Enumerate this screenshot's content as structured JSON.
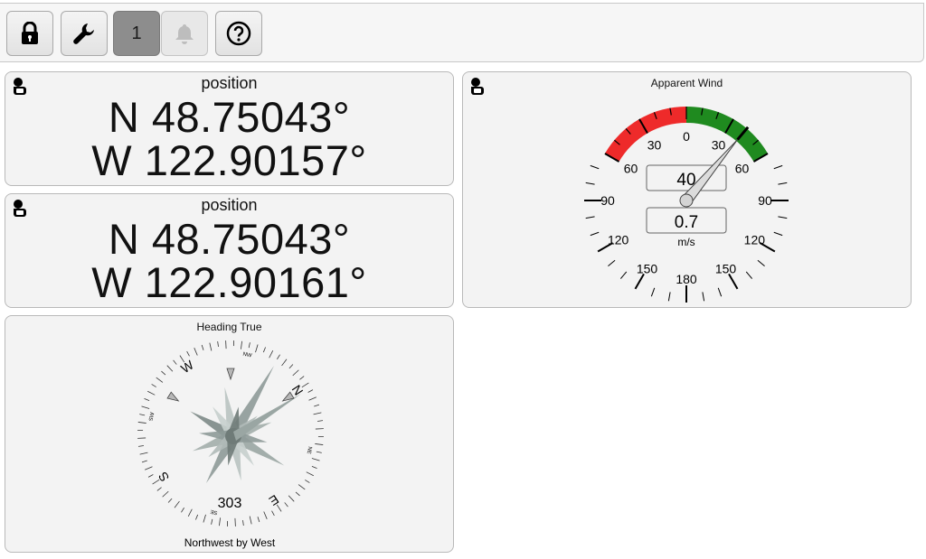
{
  "toolbar": {
    "buttons": [
      {
        "name": "lock-button",
        "icon": "lock-icon"
      },
      {
        "name": "settings-button",
        "icon": "wrench-icon"
      },
      {
        "name": "page-1-button",
        "label": "1"
      },
      {
        "name": "alarm-button",
        "icon": "bell-icon"
      },
      {
        "name": "help-button",
        "icon": "question-circle-icon"
      }
    ]
  },
  "position1": {
    "title": "position",
    "lat": "N 48.75043°",
    "lon": "W 122.90157°",
    "icon": "hand-pointer-icon"
  },
  "position2": {
    "title": "position",
    "lat": "N 48.75043°",
    "lon": "W 122.90161°",
    "icon": "hand-pointer-icon"
  },
  "wind": {
    "title": "Apparent Wind",
    "angle_value": "40",
    "angle_deg": 40,
    "speed_value": "0.7",
    "unit": "m/s",
    "scale_labels": [
      "0",
      "30",
      "30",
      "60",
      "60",
      "90",
      "90",
      "120",
      "120",
      "150",
      "150",
      "180"
    ],
    "colors": {
      "port": "#ee2a2a",
      "starboard": "#1f8a1f"
    },
    "icon": "hand-pointer-icon"
  },
  "heading": {
    "title": "Heading True",
    "value": "303",
    "heading_deg": 303,
    "description": "Northwest by West",
    "cardinals": [
      "N",
      "E",
      "S",
      "W"
    ],
    "intercardinals": [
      "NE",
      "SE",
      "SW",
      "NW"
    ]
  }
}
